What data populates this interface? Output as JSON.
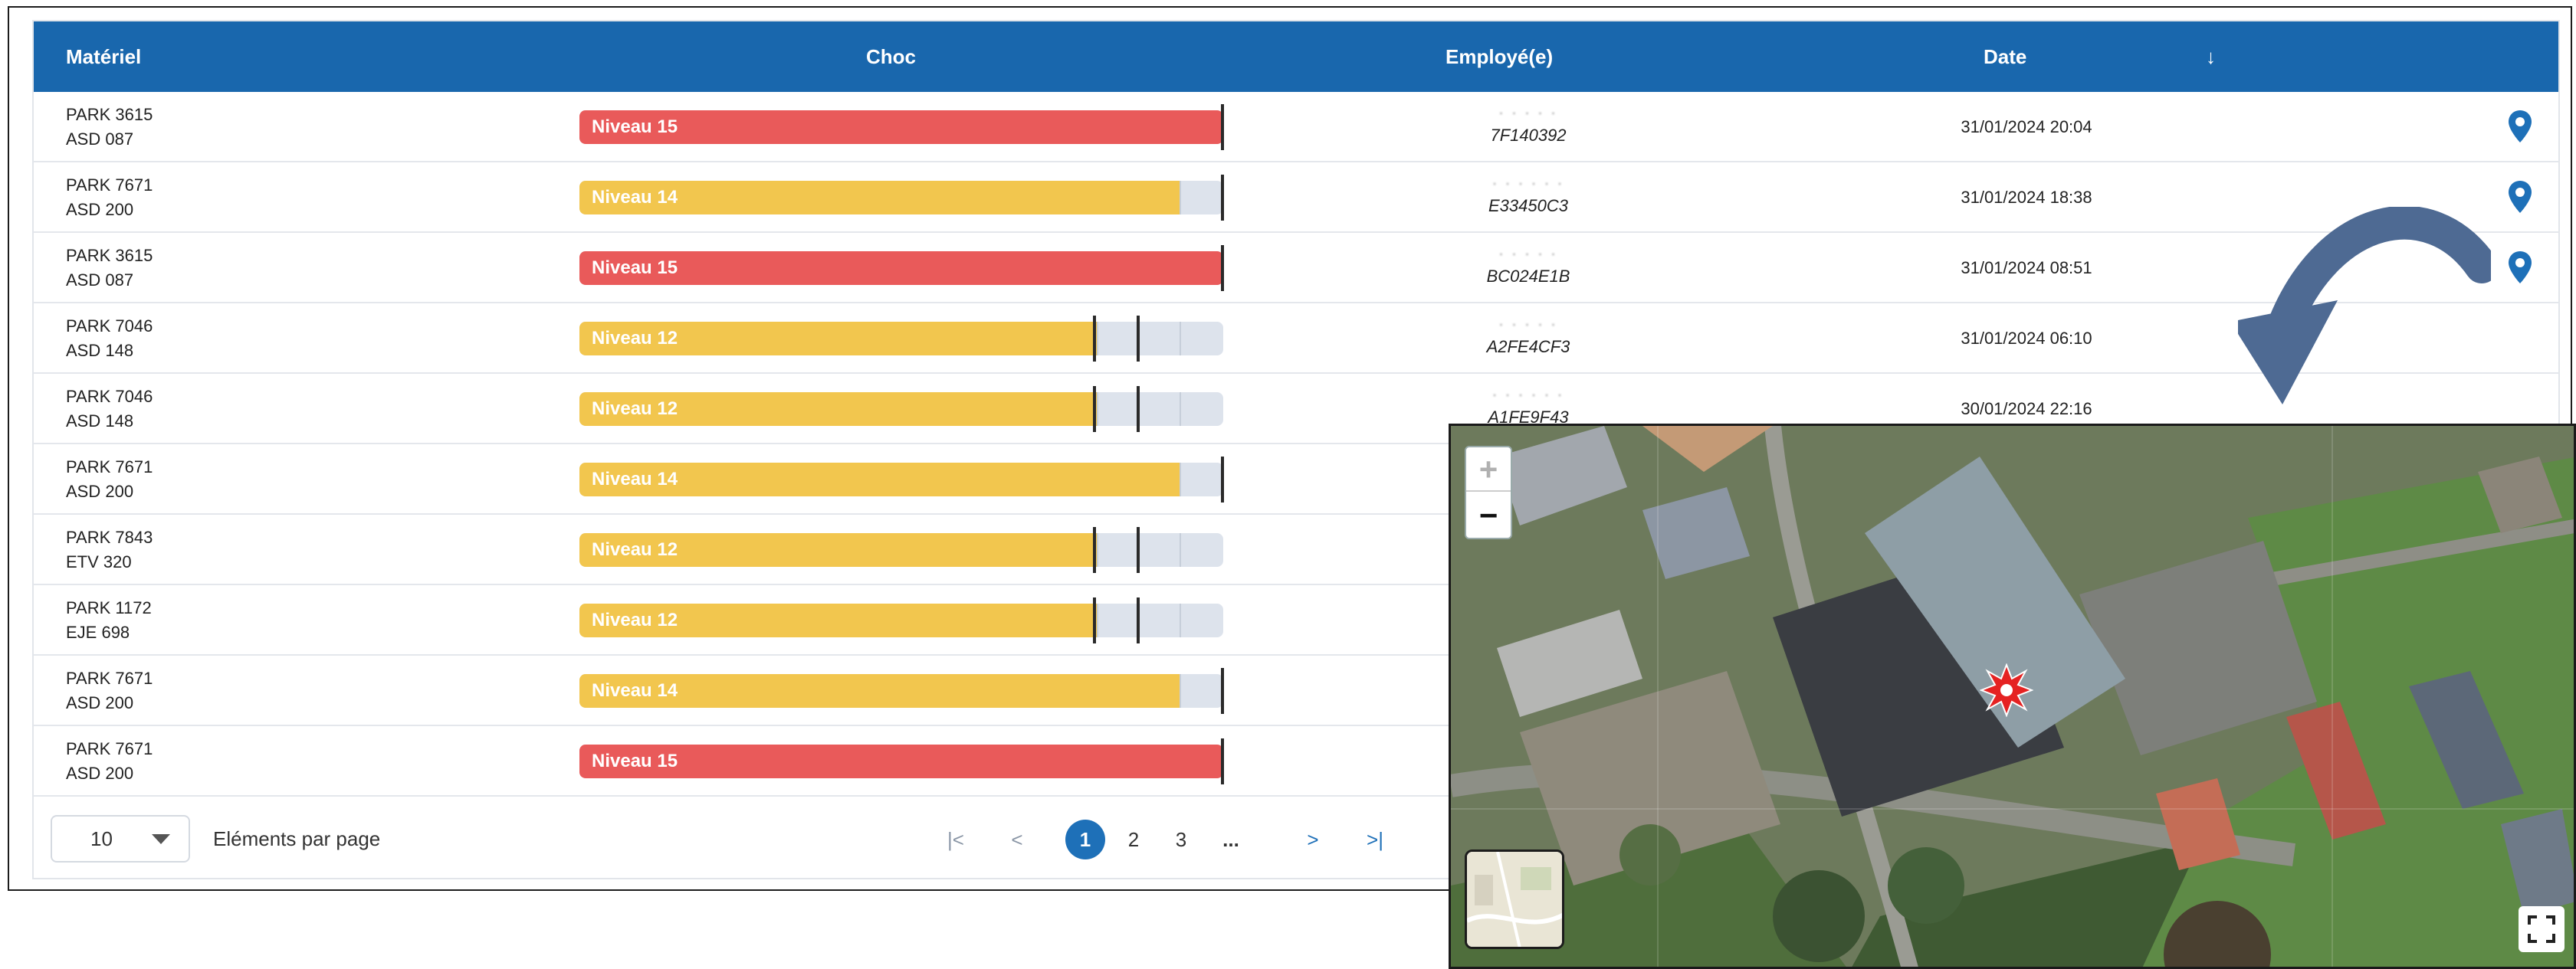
{
  "table": {
    "columns": {
      "materiel": "Matériel",
      "choc": "Choc",
      "employe": "Employé(e)",
      "date": "Date",
      "sort_icon": "↓"
    },
    "rows": [
      {
        "park": "PARK 3615",
        "code": "ASD 087",
        "level_label": "Niveau 15",
        "level": 15,
        "color": "#e95a5a",
        "employee_masked": "· · · · ·",
        "employee_id": "7F140392",
        "date": "31/01/2024 20:04",
        "has_location": true
      },
      {
        "park": "PARK 7671",
        "code": "ASD 200",
        "level_label": "Niveau 14",
        "level": 14,
        "color": "#f2c64e",
        "employee_masked": "· · · · · ·",
        "employee_id": "E33450C3",
        "date": "31/01/2024 18:38",
        "has_location": true
      },
      {
        "park": "PARK 3615",
        "code": "ASD 087",
        "level_label": "Niveau 15",
        "level": 15,
        "color": "#e95a5a",
        "employee_masked": "· · · · ·",
        "employee_id": "BC024E1B",
        "date": "31/01/2024 08:51",
        "has_location": true
      },
      {
        "park": "PARK 7046",
        "code": "ASD 148",
        "level_label": "Niveau 12",
        "level": 12,
        "color": "#f2c64e",
        "employee_masked": "· · · · ·",
        "employee_id": "A2FE4CF3",
        "date": "31/01/2024 06:10",
        "has_location": false
      },
      {
        "park": "PARK 7046",
        "code": "ASD 148",
        "level_label": "Niveau 12",
        "level": 12,
        "color": "#f2c64e",
        "employee_masked": "· · · · · ·",
        "employee_id": "A1FE9F43",
        "date": "30/01/2024 22:16",
        "has_location": false
      },
      {
        "park": "PARK 7671",
        "code": "ASD 200",
        "level_label": "Niveau 14",
        "level": 14,
        "color": "#f2c64e",
        "employee_masked": "",
        "employee_id": "",
        "date": "",
        "has_location": false
      },
      {
        "park": "PARK 7843",
        "code": "ETV 320",
        "level_label": "Niveau 12",
        "level": 12,
        "color": "#f2c64e",
        "employee_masked": "",
        "employee_id": "",
        "date": "",
        "has_location": false
      },
      {
        "park": "PARK 1172",
        "code": "EJE 698",
        "level_label": "Niveau 12",
        "level": 12,
        "color": "#f2c64e",
        "employee_masked": "",
        "employee_id": "",
        "date": "",
        "has_location": false
      },
      {
        "park": "PARK 7671",
        "code": "ASD 200",
        "level_label": "Niveau 14",
        "level": 14,
        "color": "#f2c64e",
        "employee_masked": "",
        "employee_id": "",
        "date": "",
        "has_location": false
      },
      {
        "park": "PARK 7671",
        "code": "ASD 200",
        "level_label": "Niveau 15",
        "level": 15,
        "color": "#e95a5a",
        "employee_masked": "",
        "employee_id": "",
        "date": "",
        "has_location": false
      }
    ],
    "level_max": 15
  },
  "footer": {
    "page_size": "10",
    "page_size_label": "Eléments par page",
    "first_icon": "|<",
    "prev_icon": "<",
    "pages": [
      "1",
      "2",
      "3",
      "..."
    ],
    "current_page": "1",
    "next_icon": ">",
    "last_icon": ">|"
  },
  "map": {
    "zoom_in": "+",
    "zoom_out": "−"
  },
  "colors": {
    "header": "#1967ad",
    "red": "#e95a5a",
    "yellow": "#f2c64e",
    "track": "#dde3ec",
    "pin": "#1e70b8",
    "arrow": "#4e6a93"
  }
}
